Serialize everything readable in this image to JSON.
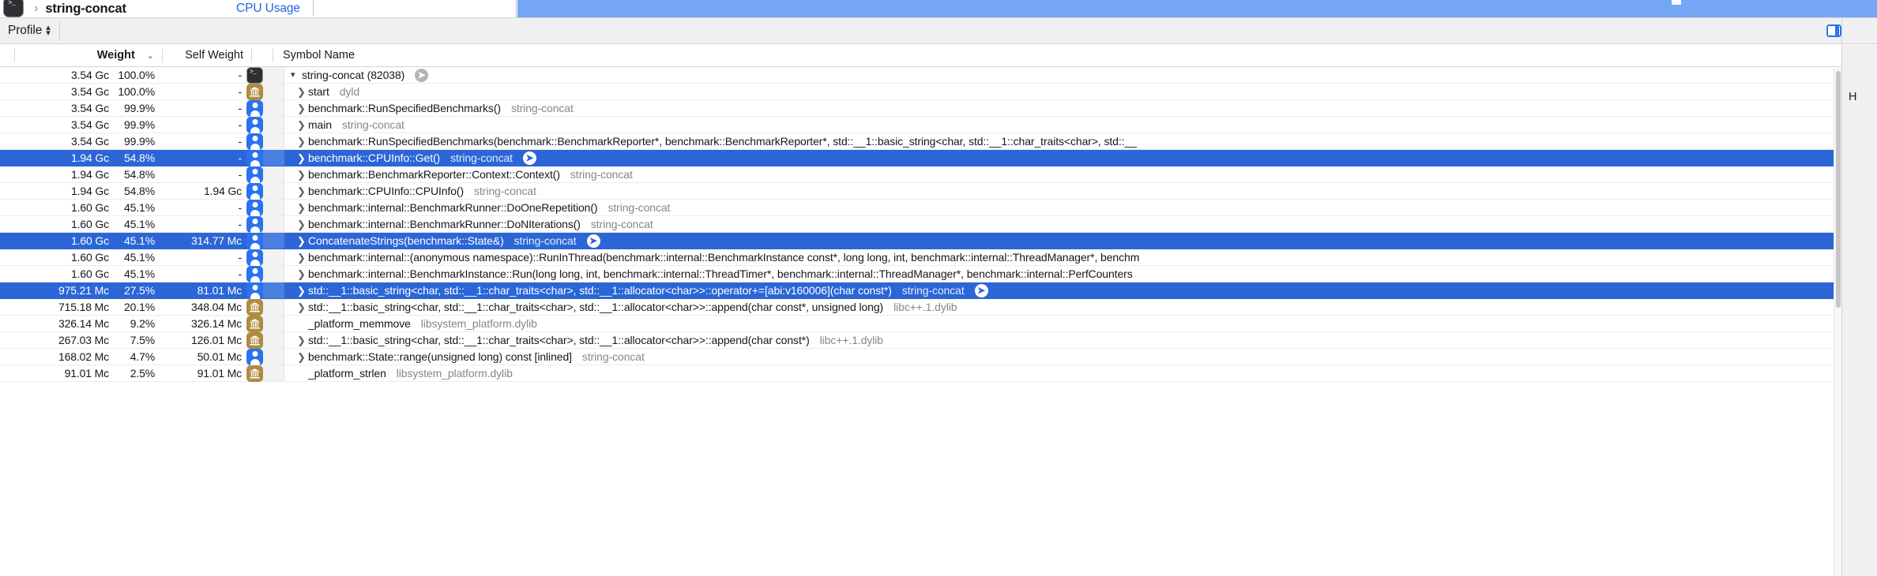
{
  "topbar": {
    "app_icon": "terminal-icon",
    "breadcrumb_chevron": "›",
    "title": "string-concat",
    "cpu_usage_label": "CPU Usage"
  },
  "profilebar": {
    "popup_label": "Profile",
    "inspector_toggle": "inspector-panel-icon"
  },
  "columns": {
    "weight": "Weight",
    "self_weight": "Self Weight",
    "symbol_name": "Symbol Name",
    "sort_caret": "⌄"
  },
  "sidepanel": {
    "heading": "H"
  },
  "rows": [
    {
      "weight": "3.54 Gc",
      "pct": "100.0%",
      "self": "-",
      "icon": "terminal",
      "disc": "open",
      "indent": 0,
      "name": "string-concat (82038)",
      "bin": "",
      "jump": true,
      "selected": false
    },
    {
      "weight": "3.54 Gc",
      "pct": "100.0%",
      "self": "-",
      "icon": "lib",
      "disc": "closed",
      "indent": 8,
      "name": "start",
      "bin": "dyld",
      "jump": false,
      "selected": false
    },
    {
      "weight": "3.54 Gc",
      "pct": "99.9%",
      "self": "-",
      "icon": "user",
      "disc": "closed",
      "indent": 8,
      "name": "benchmark::RunSpecifiedBenchmarks()",
      "bin": "string-concat",
      "jump": false,
      "selected": false
    },
    {
      "weight": "3.54 Gc",
      "pct": "99.9%",
      "self": "-",
      "icon": "user",
      "disc": "closed",
      "indent": 8,
      "name": "main",
      "bin": "string-concat",
      "jump": false,
      "selected": false
    },
    {
      "weight": "3.54 Gc",
      "pct": "99.9%",
      "self": "-",
      "icon": "user",
      "disc": "closed",
      "indent": 8,
      "name": "benchmark::RunSpecifiedBenchmarks(benchmark::BenchmarkReporter*, benchmark::BenchmarkReporter*, std::__1::basic_string<char, std::__1::char_traits<char>, std::__",
      "bin": "",
      "jump": false,
      "selected": false
    },
    {
      "weight": "1.94 Gc",
      "pct": "54.8%",
      "self": "-",
      "icon": "user",
      "disc": "closed",
      "indent": 8,
      "name": "benchmark::CPUInfo::Get()",
      "bin": "string-concat",
      "jump": true,
      "selected": true
    },
    {
      "weight": "1.94 Gc",
      "pct": "54.8%",
      "self": "-",
      "icon": "user",
      "disc": "closed",
      "indent": 8,
      "name": "benchmark::BenchmarkReporter::Context::Context()",
      "bin": "string-concat",
      "jump": false,
      "selected": false
    },
    {
      "weight": "1.94 Gc",
      "pct": "54.8%",
      "self": "1.94 Gc",
      "icon": "user",
      "disc": "closed",
      "indent": 8,
      "name": "benchmark::CPUInfo::CPUInfo()",
      "bin": "string-concat",
      "jump": false,
      "selected": false
    },
    {
      "weight": "1.60 Gc",
      "pct": "45.1%",
      "self": "-",
      "icon": "user",
      "disc": "closed",
      "indent": 8,
      "name": "benchmark::internal::BenchmarkRunner::DoOneRepetition()",
      "bin": "string-concat",
      "jump": false,
      "selected": false
    },
    {
      "weight": "1.60 Gc",
      "pct": "45.1%",
      "self": "-",
      "icon": "user",
      "disc": "closed",
      "indent": 8,
      "name": "benchmark::internal::BenchmarkRunner::DoNIterations()",
      "bin": "string-concat",
      "jump": false,
      "selected": false
    },
    {
      "weight": "1.60 Gc",
      "pct": "45.1%",
      "self": "314.77 Mc",
      "icon": "user",
      "disc": "closed",
      "indent": 8,
      "name": "ConcatenateStrings(benchmark::State&)",
      "bin": "string-concat",
      "jump": true,
      "selected": true
    },
    {
      "weight": "1.60 Gc",
      "pct": "45.1%",
      "self": "-",
      "icon": "user",
      "disc": "closed",
      "indent": 8,
      "name": "benchmark::internal::(anonymous namespace)::RunInThread(benchmark::internal::BenchmarkInstance const*, long long, int, benchmark::internal::ThreadManager*, benchm",
      "bin": "",
      "jump": false,
      "selected": false
    },
    {
      "weight": "1.60 Gc",
      "pct": "45.1%",
      "self": "-",
      "icon": "user",
      "disc": "closed",
      "indent": 8,
      "name": "benchmark::internal::BenchmarkInstance::Run(long long, int, benchmark::internal::ThreadTimer*, benchmark::internal::ThreadManager*, benchmark::internal::PerfCounters",
      "bin": "",
      "jump": false,
      "selected": false
    },
    {
      "weight": "975.21 Mc",
      "pct": "27.5%",
      "self": "81.01 Mc",
      "icon": "user",
      "disc": "closed",
      "indent": 8,
      "name": "std::__1::basic_string<char, std::__1::char_traits<char>, std::__1::allocator<char>>::operator+=[abi:v160006](char const*)",
      "bin": "string-concat",
      "jump": true,
      "selected": true
    },
    {
      "weight": "715.18 Mc",
      "pct": "20.1%",
      "self": "348.04 Mc",
      "icon": "lib",
      "disc": "closed",
      "indent": 8,
      "name": "std::__1::basic_string<char, std::__1::char_traits<char>, std::__1::allocator<char>>::append(char const*, unsigned long)",
      "bin": "libc++.1.dylib",
      "jump": false,
      "selected": false
    },
    {
      "weight": "326.14 Mc",
      "pct": "9.2%",
      "self": "326.14 Mc",
      "icon": "lib",
      "disc": "none",
      "indent": 8,
      "name": "_platform_memmove",
      "bin": "libsystem_platform.dylib",
      "jump": false,
      "selected": false
    },
    {
      "weight": "267.03 Mc",
      "pct": "7.5%",
      "self": "126.01 Mc",
      "icon": "lib",
      "disc": "closed",
      "indent": 8,
      "name": "std::__1::basic_string<char, std::__1::char_traits<char>, std::__1::allocator<char>>::append(char const*)",
      "bin": "libc++.1.dylib",
      "jump": false,
      "selected": false
    },
    {
      "weight": "168.02 Mc",
      "pct": "4.7%",
      "self": "50.01 Mc",
      "icon": "user",
      "disc": "closed",
      "indent": 8,
      "name": "benchmark::State::range(unsigned long) const [inlined]",
      "bin": "string-concat",
      "jump": false,
      "selected": false
    },
    {
      "weight": "91.01 Mc",
      "pct": "2.5%",
      "self": "91.01 Mc",
      "icon": "lib",
      "disc": "none",
      "indent": 8,
      "name": "_platform_strlen",
      "bin": "libsystem_platform.dylib",
      "jump": false,
      "selected": false
    }
  ]
}
